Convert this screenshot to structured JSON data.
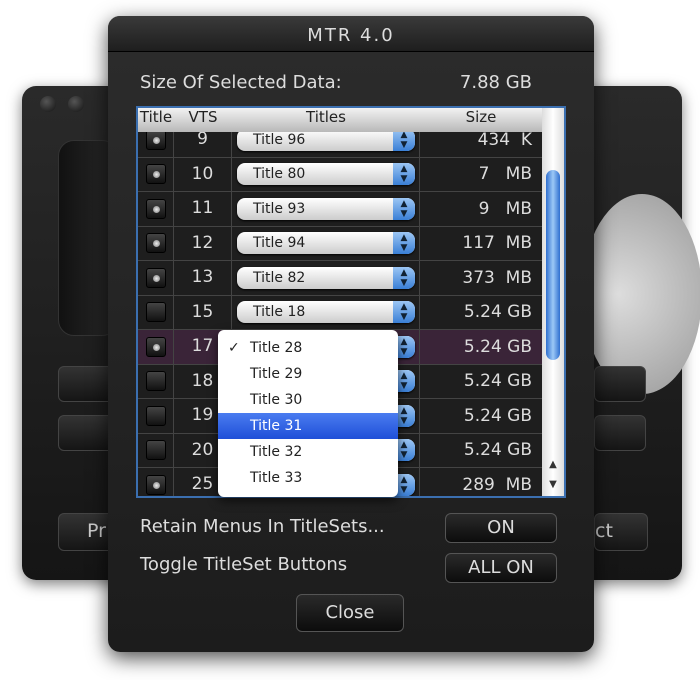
{
  "background_window": {
    "left_button_partial": "Pr",
    "right_button_partial": "ct"
  },
  "window": {
    "title": "MTR 4.0"
  },
  "summary": {
    "label": "Size Of Selected Data:",
    "value": "7.88 GB"
  },
  "table": {
    "headers": [
      "Title",
      "VTS",
      "Titles",
      "Size"
    ],
    "rows": [
      {
        "checked": true,
        "vts": "9",
        "title": "Title 96",
        "size": "434  K"
      },
      {
        "checked": true,
        "vts": "10",
        "title": "Title 80",
        "size": "7   MB"
      },
      {
        "checked": true,
        "vts": "11",
        "title": "Title 93",
        "size": "9   MB"
      },
      {
        "checked": true,
        "vts": "12",
        "title": "Title 94",
        "size": "117  MB"
      },
      {
        "checked": true,
        "vts": "13",
        "title": "Title 82",
        "size": "373  MB"
      },
      {
        "checked": false,
        "vts": "15",
        "title": "Title 18",
        "size": "5.24 GB"
      },
      {
        "checked": true,
        "vts": "17",
        "title": "Title 28",
        "size": "5.24 GB",
        "selected": true
      },
      {
        "checked": false,
        "vts": "18",
        "title": "",
        "size": "5.24 GB"
      },
      {
        "checked": false,
        "vts": "19",
        "title": "",
        "size": "5.24 GB"
      },
      {
        "checked": false,
        "vts": "20",
        "title": "",
        "size": "5.24 GB"
      },
      {
        "checked": true,
        "vts": "25",
        "title": "",
        "size": "289  MB"
      }
    ]
  },
  "dropdown": {
    "items": [
      "Title 28",
      "Title 29",
      "Title 30",
      "Title 31",
      "Title 32",
      "Title 33"
    ],
    "checked": "Title 28",
    "highlighted": "Title 31"
  },
  "options": {
    "retain_label": "Retain Menus In TitleSets...",
    "retain_button": "ON",
    "toggle_label": "Toggle TitleSet Buttons",
    "toggle_button": "ALL ON"
  },
  "close_button": "Close",
  "colors": {
    "accent": "#2f6fd0",
    "selected_row": "#3a2438",
    "menu_highlight": "#1f4fd8"
  }
}
